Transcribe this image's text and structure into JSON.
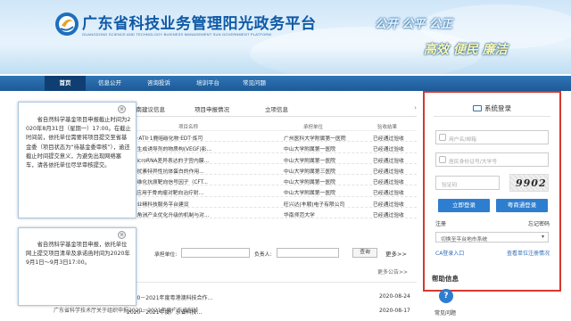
{
  "header": {
    "title": "广东省科技业务管理阳光政务平台",
    "subtitle": "GUANGDONG SCIENCE AND TECHNOLOGY BUSINESS MANAGEMENT SUN GOVERNMENT PLATFORM",
    "slogan_line1": "公开  公平  公正",
    "slogan_line2": "高效  便民  廉洁"
  },
  "nav": {
    "items": [
      {
        "label": "首页"
      },
      {
        "label": "信息公开"
      },
      {
        "label": "咨询投诉"
      },
      {
        "label": "培训平台"
      },
      {
        "label": "常见问题"
      }
    ]
  },
  "main_tabs": {
    "tabs": [
      {
        "label": "指南建议信息"
      },
      {
        "label": "项目申报情况"
      },
      {
        "label": "立项信息"
      }
    ],
    "more": "›"
  },
  "table": {
    "headers": [
      "项目名称",
      "承担单位",
      "验收结果"
    ],
    "rows": [
      {
        "name": "化科·ATII·1鹿赔碳化物·EDT·炼可",
        "unit": "广州医科大学附属第一医院",
        "result": "已经通过验收"
      },
      {
        "name": "血管生成诱导剂的物质构(VEGF)影...",
        "unit": "中山大学附属第一医院",
        "result": "已经通过验收"
      },
      {
        "name": "于microRNA差异表达的子宫内膜...",
        "unit": "中山大学附属第一医院",
        "result": "已经通过验收"
      },
      {
        "name": "于干扰素特异性抗体蛋白的作用...",
        "unit": "中山大学附属第三医院",
        "result": "已经通过验收"
      },
      {
        "name": "性纤维化抗原靶向信号因子（CFT...",
        "unit": "中山大学附属第一医院",
        "result": "已经通过验收"
      },
      {
        "name": "BP2应用于骨肉瘤对靶向治疗射...",
        "unit": "中山大学附属第一医院",
        "result": "已经通过验收"
      },
      {
        "name": "声专业精科技服务平台建设",
        "unit": "旺兴达(丰顺)电子有限公司",
        "result": "已经通过验收"
      },
      {
        "name": "江三角洲产业优化升级的机制与对...",
        "unit": "华南师范大学",
        "result": "已经通过验收"
      }
    ]
  },
  "search": {
    "unit_label": "承担单位:",
    "person_label": "负责人:",
    "button": "查询",
    "more": "更多>>"
  },
  "bottom_list": {
    "more": "更多公告>>",
    "items": [
      {
        "title": "2020－2021年度粤港澳科技合作...",
        "date": "2020-08-24"
      },
      {
        "title": "2020－2021年度广东省科技...",
        "date": "2020-08-17"
      }
    ],
    "caption": "广东省科学技术厅关于组织申报2020－2021年度广东省科技"
  },
  "popup1": {
    "close": "×",
    "text": "省自然科学基金项目申报截止时间为2020年8月31日（星期一）17:00。在截止时间前，依托单位需要将项目提交至省基金委（项目状态为“待基金委审核”），逾还截止时间提交意义，为避免出现网络塞车，请各依托单位尽早审核提交。"
  },
  "popup2": {
    "close": "×",
    "text": "省自然科学基金项目申报，依托单位网上提交项目清单及承诺函时间为2020年9月1日～9月3日17:00。",
    "note": "……………………"
  },
  "login": {
    "title": "系统登录",
    "username_placeholder": "用户名/邮箱",
    "id_placeholder": "居民身份证号/大学号",
    "captcha_placeholder": "验证码",
    "captcha_text": "9902",
    "login_button": "立即登录",
    "other_login_button": "粤商通登录",
    "register": "注册",
    "forgot": "忘记密码",
    "switch_select": "切换至平台地市系统",
    "ca_link": "CA登录入口",
    "process_link": "查看单位注册情况"
  },
  "help": {
    "title": "帮助信息",
    "icon": "?",
    "label": "常见问题"
  }
}
